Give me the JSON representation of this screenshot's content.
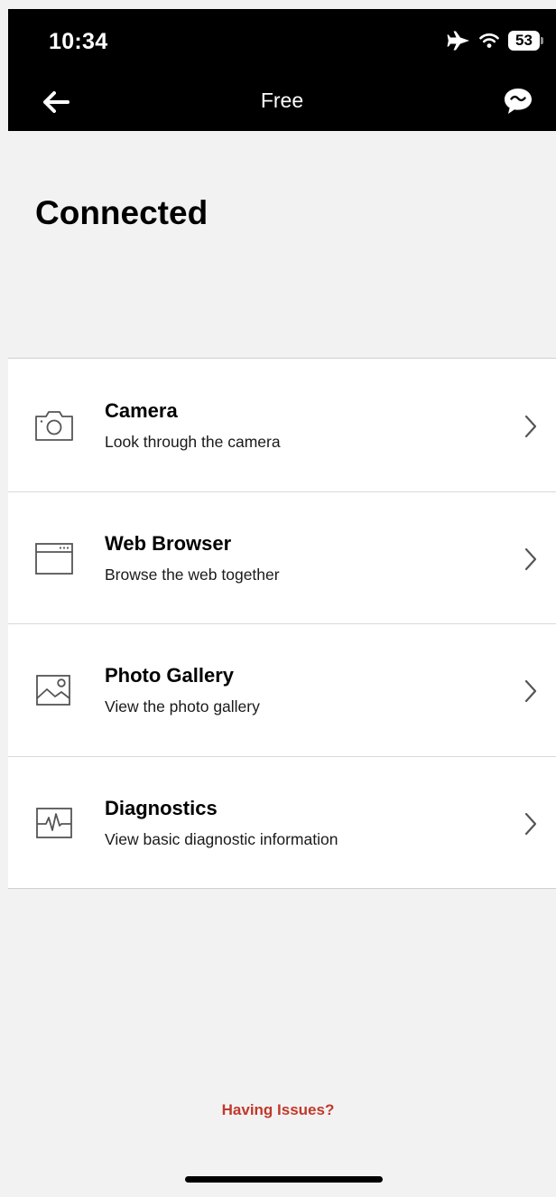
{
  "status_bar": {
    "time": "10:34",
    "battery": "53"
  },
  "nav": {
    "title": "Free"
  },
  "heading": "Connected",
  "items": [
    {
      "title": "Camera",
      "subtitle": "Look through the camera",
      "icon": "camera-icon"
    },
    {
      "title": "Web Browser",
      "subtitle": "Browse the web together",
      "icon": "browser-window-icon"
    },
    {
      "title": "Photo Gallery",
      "subtitle": "View the photo gallery",
      "icon": "image-icon"
    },
    {
      "title": "Diagnostics",
      "subtitle": "View basic diagnostic information",
      "icon": "pulse-monitor-icon"
    }
  ],
  "help_link": "Having Issues?",
  "colors": {
    "background": "#f2f2f2",
    "header": "#000000",
    "list_background": "#ffffff",
    "link": "#c0392b"
  }
}
